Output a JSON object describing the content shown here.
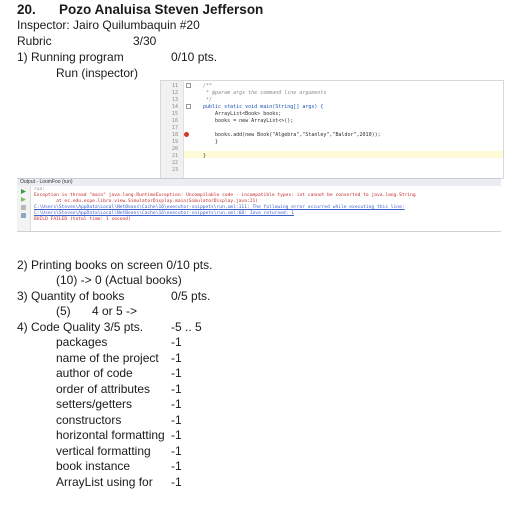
{
  "header": {
    "number": "20.",
    "student": "Pozo Analuisa Steven Jefferson",
    "inspector": "Inspector: Jairo Quilumbaquin #20",
    "rubric_label": "Rubric",
    "rubric_score": "3/30"
  },
  "section1": {
    "title": "1) Running program",
    "score": "0/10 pts.",
    "sub": "Run (inspector)"
  },
  "code": {
    "line_numbers": [
      "11",
      "12",
      "13",
      "14",
      "15",
      "16",
      "17",
      "18",
      "19",
      "20",
      "21",
      "22",
      "23"
    ],
    "lines": [
      "/**",
      " * @param args the command line arguments",
      " */",
      "public static void main(String[] args) {",
      "    ArrayList<Book> books;",
      "    books = new ArrayList<>();",
      "",
      "    books.add(new Book(\"Algebra\",\"Stanley\",\"Baldor\",2010));",
      "    }",
      "",
      "}",
      "",
      ""
    ]
  },
  "output": {
    "tab": "Output - LoomFoo (run)",
    "lines": [
      "run:",
      "Exception in thread \"main\" java.lang.RuntimeException: Uncompilable code - incompatible types: int cannot be converted to java.lang.String",
      "        at ec.edu.espe.libro.view.SimulatorDisplay.main(SimulatorDisplay.java:21)",
      "C:\\Users\\Steven\\AppData\\Local\\NetBeans\\Cache\\16\\executor-snippets\\run.xml:111: The following error occurred while executing this line:",
      "C:\\Users\\Steven\\AppData\\Local\\NetBeans\\Cache\\16\\executor-snippets\\run.xml:68: Java returned: 1",
      "BUILD FAILED (total time: 1 second)"
    ]
  },
  "section2": {
    "title": "2) Printing books on screen 0/10 pts.",
    "sub": "(10) -> 0 (Actual books)"
  },
  "section3": {
    "title": "3) Quantity of books",
    "score": "0/5 pts.",
    "sub_a": "(5)",
    "sub_b": "4 or 5 ->"
  },
  "section4": {
    "title": "4) Code Quality 3/5 pts.",
    "range": "-5 .. 5",
    "items": [
      {
        "label": "packages",
        "value": "-1"
      },
      {
        "label": "name of the project",
        "value": "-1"
      },
      {
        "label": "author of code",
        "value": "-1"
      },
      {
        "label": "order of attributes",
        "value": "-1"
      },
      {
        "label": "setters/getters",
        "value": "-1"
      },
      {
        "label": "constructors",
        "value": "-1"
      },
      {
        "label": "horizontal formatting",
        "value": "-1"
      },
      {
        "label": "vertical formatting",
        "value": "-1"
      },
      {
        "label": "book instance",
        "value": "-1"
      },
      {
        "label": "ArrayList using for",
        "value": "-1"
      }
    ]
  },
  "colors": {
    "error": "#c62828",
    "link": "#3a5fcd",
    "current_line": "#fffbd8"
  }
}
